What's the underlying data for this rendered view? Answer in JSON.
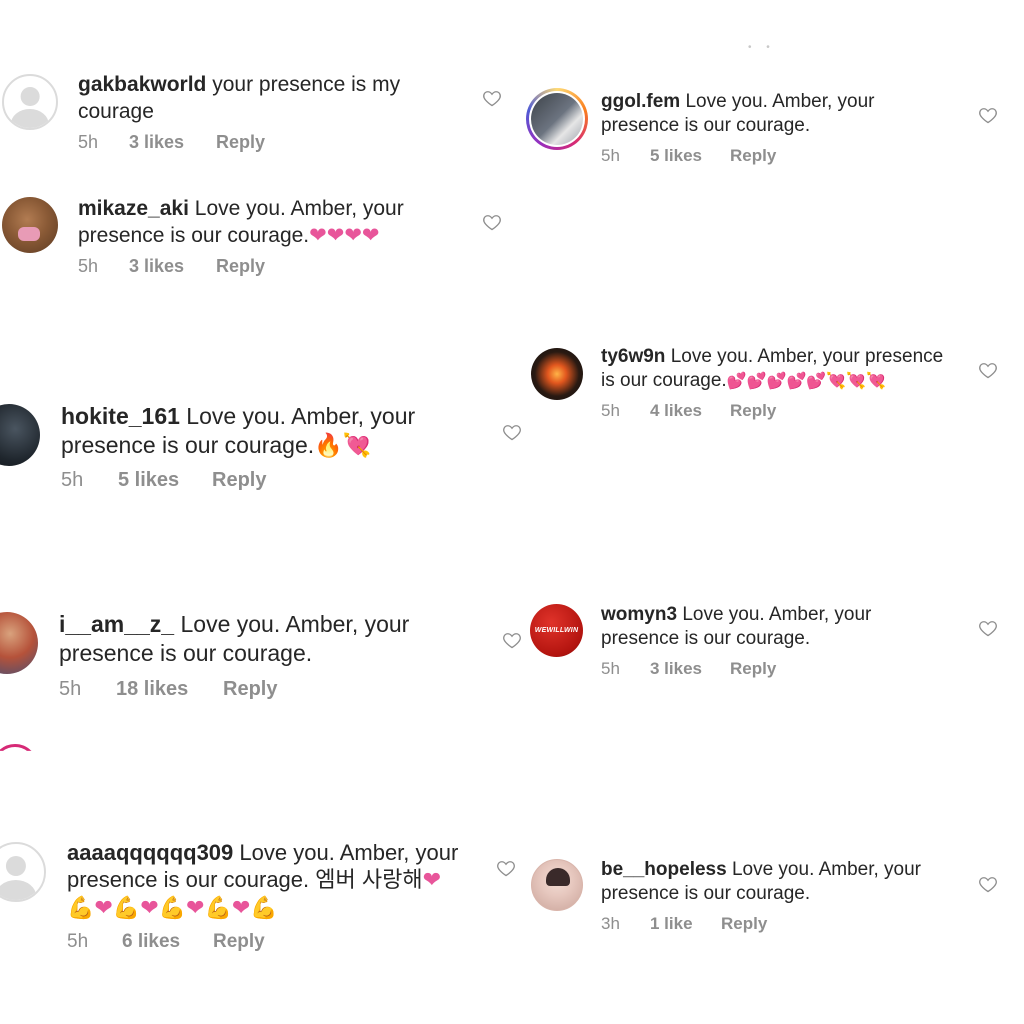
{
  "comments": [
    {
      "user": "gakbakworld",
      "text_line1": "your presence is my",
      "text_line2": "courage",
      "time": "5h",
      "likes": "3 likes",
      "reply": "Reply"
    },
    {
      "user": "mikaze_aki",
      "text_line1": "Love you. Amber, your",
      "text_line2": "presence is our courage.",
      "emoji": "❤❤❤❤",
      "time": "5h",
      "likes": "3 likes",
      "reply": "Reply"
    },
    {
      "user": "hokite_161",
      "text_line1": "Love you. Amber, your",
      "text_line2": "presence is our courage.",
      "emoji": "🔥💘",
      "time": "5h",
      "likes": "5 likes",
      "reply": "Reply"
    },
    {
      "user": "i__am__z_",
      "text_line1": "Love you. Amber, your",
      "text_line2": "presence is our courage.",
      "time": "5h",
      "likes": "18 likes",
      "reply": "Reply"
    },
    {
      "user": "aaaaqqqqqq309",
      "text_line1": "Love you. Amber, your",
      "text_line2": "presence is our courage. 엠버 사랑해",
      "emoji": "❤",
      "text_line3": "💪❤💪❤💪❤💪❤💪",
      "time": "5h",
      "likes": "6 likes",
      "reply": "Reply"
    },
    {
      "user": "ggol.fem",
      "text_line1": "Love you. Amber, your",
      "text_line2": "presence is our courage.",
      "time": "5h",
      "likes": "5 likes",
      "reply": "Reply"
    },
    {
      "user": "ty6w9n",
      "text_line1": "Love you. Amber, your presence",
      "text_line2": "is our courage.",
      "emoji": "💕💕💕💕💕💘💘💘",
      "time": "5h",
      "likes": "4 likes",
      "reply": "Reply"
    },
    {
      "user": "womyn3",
      "text_line1": "Love you. Amber, your",
      "text_line2": "presence is our courage.",
      "avatar_text": "WEWILLWIN",
      "time": "5h",
      "likes": "3 likes",
      "reply": "Reply"
    },
    {
      "user": "be__hopeless",
      "text_line1": "Love you. Amber, your",
      "text_line2": "presence is our courage.",
      "time": "3h",
      "likes": "1 like",
      "reply": "Reply"
    }
  ],
  "icons": {
    "like": "heart-outline-icon",
    "avatar_default": "default-avatar-icon"
  },
  "colors": {
    "text": "#262626",
    "meta": "#8e8e8e",
    "heart_emoji": "#e8559a",
    "story_ring": "#d62976"
  }
}
